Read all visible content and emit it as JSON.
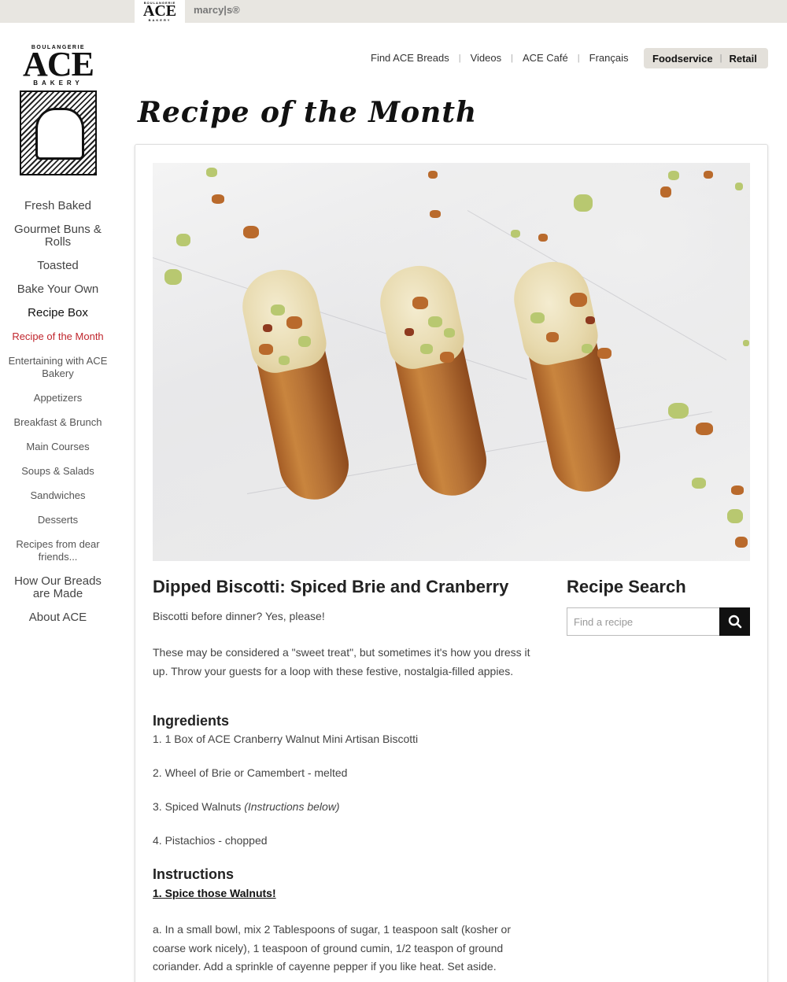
{
  "brand_bar": {
    "ace_small_top": "BOULANGERIE",
    "ace_label": "ACE",
    "ace_small_bottom": "BAKERY",
    "marcys_label": "marcy|s®"
  },
  "logo": {
    "line1": "BOULANGERIE",
    "line2": "ACE",
    "line3": "BAKERY"
  },
  "sidebar": {
    "main_items": [
      "Fresh Baked",
      "Gourmet Buns & Rolls",
      "Toasted",
      "Bake Your Own",
      "Recipe Box"
    ],
    "sub_items": [
      "Recipe of the Month",
      "Entertaining with ACE Bakery",
      "Appetizers",
      "Breakfast & Brunch",
      "Main Courses",
      "Soups & Salads",
      "Sandwiches",
      "Desserts",
      "Recipes from dear friends..."
    ],
    "bottom_items": [
      "How Our Breads are Made",
      "About ACE"
    ]
  },
  "topnav": {
    "links": [
      "Find ACE Breads",
      "Videos",
      "ACE Café",
      "Français"
    ],
    "separator": "|",
    "pill": [
      "Foodservice",
      "Retail"
    ]
  },
  "page": {
    "title": "Recipe of the Month"
  },
  "article": {
    "title": "Dipped Biscotti: Spiced Brie and Cranberry",
    "intro": "Biscotti before dinner? Yes, please!",
    "body": "These may be considered a \"sweet treat\", but sometimes it's how you dress it up. Throw your guests for a loop with these festive, nostalgia-filled appies.",
    "ingredients_heading": "Ingredients",
    "ingredients": [
      "1. 1 Box of ACE Cranberry Walnut Mini Artisan Biscotti",
      "2. Wheel of Brie or Camembert - melted",
      "3. Spiced Walnuts ",
      "4. Pistachios - chopped"
    ],
    "ingredient_3_note": "(Instructions below)",
    "instructions_heading": "Instructions",
    "step1_heading": "1. Spice those Walnuts!",
    "step1_a": "a. In a small bowl, mix 2 Tablespoons of sugar, 1 teaspoon salt (kosher or coarse work nicely), 1 teaspoon of ground cumin, 1/2 teaspon of ground coriander. Add a sprinkle of cayenne pepper if you like heat. Set aside."
  },
  "recipe_search": {
    "title": "Recipe Search",
    "placeholder": "Find a recipe",
    "button_icon": "search-icon"
  },
  "colors": {
    "accent_red": "#c0262d",
    "top_bar": "#e8e6e1",
    "search_button": "#111111"
  }
}
